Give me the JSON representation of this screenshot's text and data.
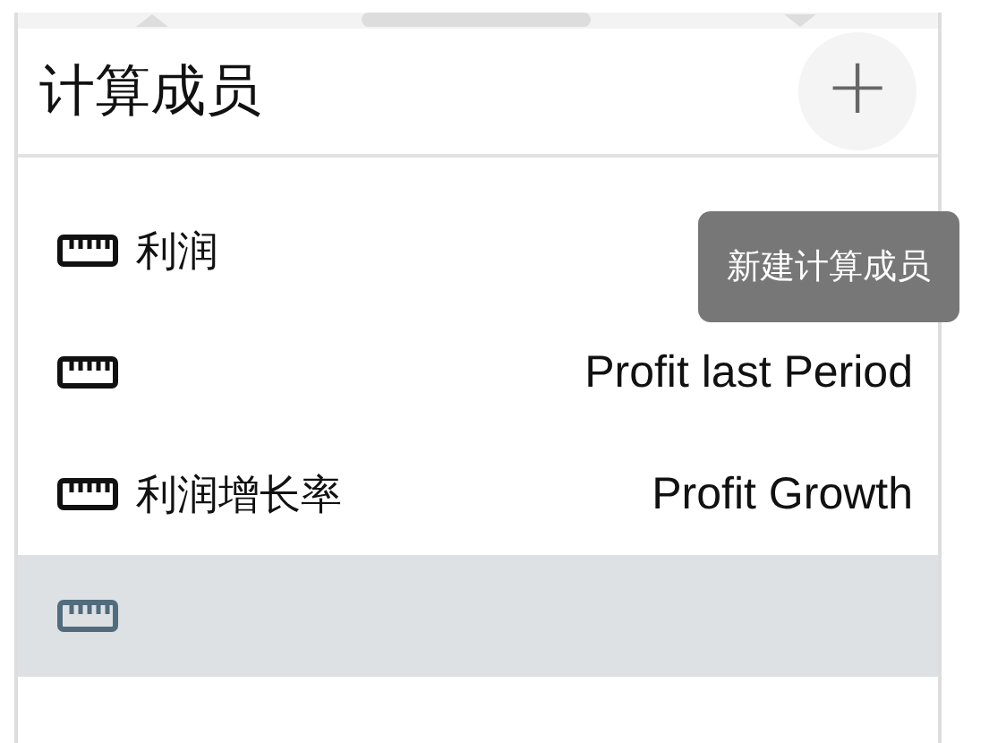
{
  "panel": {
    "title": "计算成员",
    "add_button": {
      "label": "+"
    },
    "tooltip": "新建计算成员"
  },
  "members": [
    {
      "name": "利润",
      "selected": false
    },
    {
      "caption": "Profit last Period",
      "selected": false
    },
    {
      "name": "利润增长率",
      "caption": "Profit Growth",
      "selected": false
    },
    {
      "selected": true
    }
  ]
}
